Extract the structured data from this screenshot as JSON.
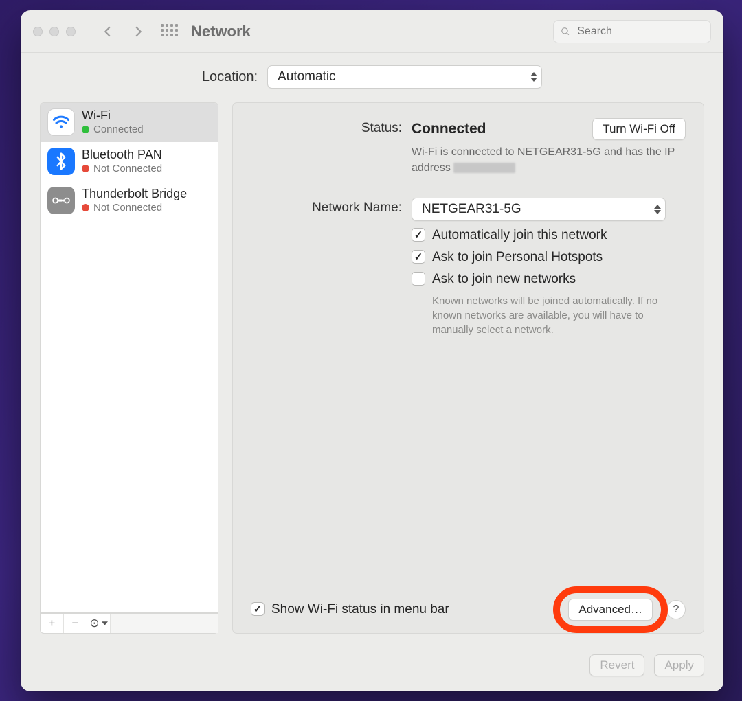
{
  "toolbar": {
    "title": "Network",
    "search_placeholder": "Search"
  },
  "location": {
    "label": "Location:",
    "selected": "Automatic"
  },
  "sidebar": {
    "items": [
      {
        "name": "Wi-Fi",
        "status": "Connected",
        "dot": "green",
        "icon": "wifi",
        "selected": true
      },
      {
        "name": "Bluetooth PAN",
        "status": "Not Connected",
        "dot": "red",
        "icon": "bluetooth",
        "selected": false
      },
      {
        "name": "Thunderbolt Bridge",
        "status": "Not Connected",
        "dot": "red",
        "icon": "thunderbolt",
        "selected": false
      }
    ],
    "tools": {
      "add": "+",
      "remove": "−",
      "more": "⊙"
    }
  },
  "detail": {
    "status_label": "Status:",
    "status_value": "Connected",
    "toggle_button": "Turn Wi-Fi Off",
    "status_sub_a": "Wi-Fi is connected to NETGEAR31-5G and has the IP address ",
    "network_label": "Network Name:",
    "network_selected": "NETGEAR31-5G",
    "checks": {
      "auto_join": "Automatically join this network",
      "ask_hotspot": "Ask to join Personal Hotspots",
      "ask_new": "Ask to join new networks",
      "ask_new_hint": "Known networks will be joined automatically. If no known networks are available, you will have to manually select a network."
    },
    "show_menubar": "Show Wi-Fi status in menu bar",
    "advanced_button": "Advanced…",
    "help": "?"
  },
  "footer": {
    "revert": "Revert",
    "apply": "Apply"
  }
}
